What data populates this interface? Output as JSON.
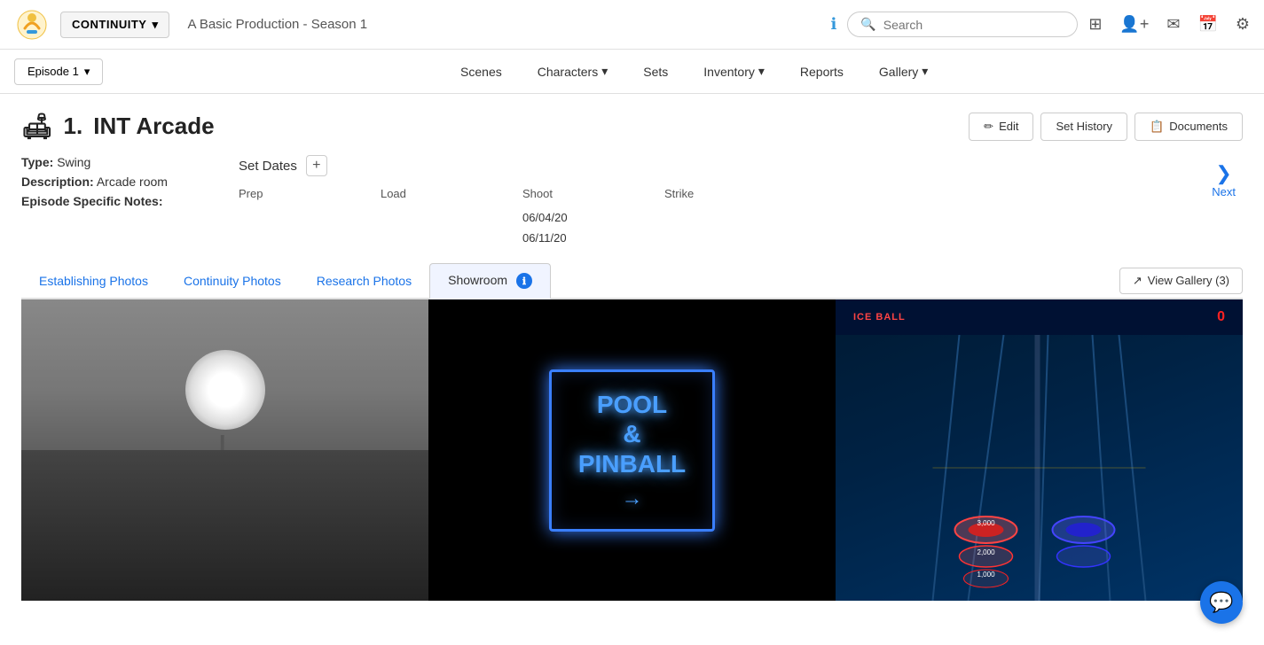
{
  "app": {
    "logo_alt": "Continuity App Logo",
    "brand": "CONTINUITY",
    "dropdown_arrow": "▾",
    "production_title": "A Basic Production - Season 1"
  },
  "topnav": {
    "search_placeholder": "Search",
    "icons": [
      "grid-icon",
      "user-add-icon",
      "mail-icon",
      "calendar-icon",
      "gear-icon"
    ]
  },
  "subnav": {
    "episode_label": "Episode 1",
    "links": [
      "Scenes",
      "Characters",
      "Sets",
      "Inventory",
      "Reports",
      "Gallery"
    ]
  },
  "scene": {
    "number": "1.",
    "name": "INT Arcade",
    "icon": "🛋",
    "type_label": "Type:",
    "type_value": "Swing",
    "description_label": "Description:",
    "description_value": "Arcade room",
    "notes_label": "Episode Specific Notes:",
    "notes_value": ""
  },
  "actions": {
    "edit_label": "Edit",
    "set_history_label": "Set History",
    "documents_label": "Documents"
  },
  "set_dates": {
    "title": "Set Dates",
    "add_btn": "+",
    "columns": {
      "prep": "Prep",
      "load": "Load",
      "shoot": "Shoot",
      "strike": "Strike"
    },
    "shoot_dates": [
      "06/04/20",
      "06/11/20"
    ]
  },
  "next_btn": {
    "label": "Next",
    "arrow": "❯"
  },
  "tabs": {
    "items": [
      {
        "id": "establishing",
        "label": "Establishing Photos",
        "active": false
      },
      {
        "id": "continuity",
        "label": "Continuity Photos",
        "active": false
      },
      {
        "id": "research",
        "label": "Research Photos",
        "active": false
      },
      {
        "id": "showroom",
        "label": "Showroom",
        "active": true
      }
    ],
    "info_icon": "ℹ",
    "view_gallery_label": "View Gallery (3)",
    "view_gallery_icon": "↗"
  },
  "photos": [
    {
      "id": "photo1",
      "type": "bar",
      "alt": "Bar with stools and spotlight"
    },
    {
      "id": "photo2",
      "type": "neon",
      "alt": "Pool and Pinball neon sign"
    },
    {
      "id": "photo3",
      "type": "arcade",
      "alt": "Skee-ball arcade game"
    }
  ],
  "chat": {
    "icon": "💬"
  }
}
